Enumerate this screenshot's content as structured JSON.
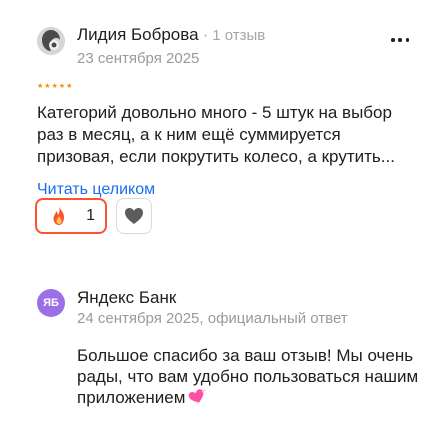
{
  "review": {
    "author_name": "Лидия Боброва",
    "author_reviews": "1 отзыв",
    "date": "23 сентября 2025",
    "rating": 5,
    "text": "Категорий довольно много - 5 штук на выбор раз в месяц, а к ним ещё суммируется призовая, если покрутить колесо, а крутить...",
    "read_more": "Читать целиком",
    "reactions": {
      "fire_icon": "fire-icon",
      "fire_count": "1",
      "like_icon": "heart-icon"
    }
  },
  "answer": {
    "avatar_text": "ЯБ",
    "author": "Яндекс Банк",
    "meta": "24 сентября 2025, официальный ответ",
    "text": "Большое спасибо за ваш отзыв! Мы очень рады, что вам удобно пользоваться нашим приложением"
  },
  "colors": {
    "accent_link": "#1a6eef",
    "star": "#fc8b00",
    "fire_border": "#fc5230",
    "bank_avatar": "#9b6fe8"
  }
}
